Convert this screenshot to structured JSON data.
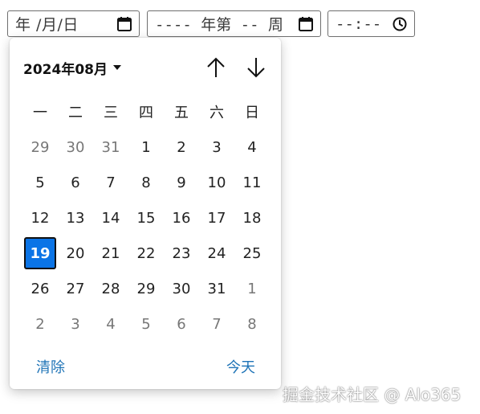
{
  "inputs": {
    "date": {
      "text": "年 /月/日",
      "icon": "calendar-icon"
    },
    "week": {
      "text": "---- 年第 -- 周",
      "icon": "calendar-icon"
    },
    "time": {
      "text": "--:--",
      "icon": "clock-icon"
    }
  },
  "calendar": {
    "month_label": "2024年08月",
    "weekdays": [
      "一",
      "二",
      "三",
      "四",
      "五",
      "六",
      "日"
    ],
    "weeks": [
      [
        {
          "d": "29",
          "m": true
        },
        {
          "d": "30",
          "m": true
        },
        {
          "d": "31",
          "m": true
        },
        {
          "d": "1"
        },
        {
          "d": "2"
        },
        {
          "d": "3"
        },
        {
          "d": "4"
        }
      ],
      [
        {
          "d": "5"
        },
        {
          "d": "6"
        },
        {
          "d": "7"
        },
        {
          "d": "8"
        },
        {
          "d": "9"
        },
        {
          "d": "10"
        },
        {
          "d": "11"
        }
      ],
      [
        {
          "d": "12"
        },
        {
          "d": "13"
        },
        {
          "d": "14"
        },
        {
          "d": "15"
        },
        {
          "d": "16"
        },
        {
          "d": "17"
        },
        {
          "d": "18"
        }
      ],
      [
        {
          "d": "19",
          "sel": true
        },
        {
          "d": "20"
        },
        {
          "d": "21"
        },
        {
          "d": "22"
        },
        {
          "d": "23"
        },
        {
          "d": "24"
        },
        {
          "d": "25"
        }
      ],
      [
        {
          "d": "26"
        },
        {
          "d": "27"
        },
        {
          "d": "28"
        },
        {
          "d": "29"
        },
        {
          "d": "30"
        },
        {
          "d": "31"
        },
        {
          "d": "1",
          "m": true
        }
      ],
      [
        {
          "d": "2",
          "m": true
        },
        {
          "d": "3",
          "m": true
        },
        {
          "d": "4",
          "m": true
        },
        {
          "d": "5",
          "m": true
        },
        {
          "d": "6",
          "m": true
        },
        {
          "d": "7",
          "m": true
        },
        {
          "d": "8",
          "m": true
        }
      ]
    ],
    "clear_label": "清除",
    "today_label": "今天",
    "colors": {
      "selected": "#0b74e6",
      "link": "#1f74b7"
    }
  },
  "watermark": "掘金技术社区 @ Alo365"
}
